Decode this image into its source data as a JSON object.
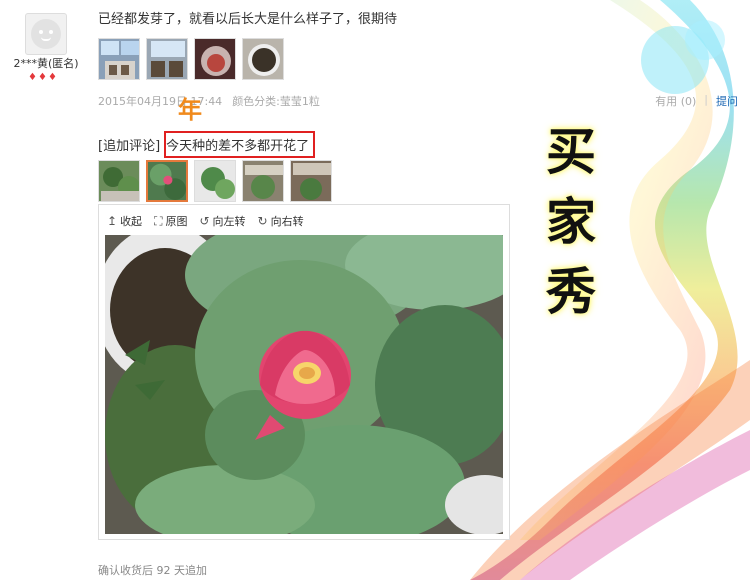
{
  "user": {
    "name": "2***黄(匿名)",
    "rank_icons": [
      "♦",
      "♦",
      "♦"
    ]
  },
  "first_review": {
    "text": "已经都发芽了，就看以后长大是什么样子了，很期待",
    "date": "2015年04月19日 17:44",
    "category": "颜色分类:莹莹1粒",
    "useful_label": "有用",
    "useful_count": "(0)",
    "ask_label": "提问"
  },
  "annotation": {
    "orange_char": "年"
  },
  "append_review": {
    "prefix": "[追加评论]",
    "text": "今天种的差不多都开花了"
  },
  "viewer": {
    "collapse_label": "收起",
    "original_label": "原图",
    "rotate_left_label": "向左转",
    "rotate_right_label": "向右转"
  },
  "footer": {
    "note": "确认收货后 92 天追加"
  },
  "overlay_title": [
    "买",
    "家",
    "秀"
  ],
  "colors": {
    "accent_red": "#e02020",
    "accent_orange": "#f08a1c",
    "link_blue": "#1a66b3"
  }
}
